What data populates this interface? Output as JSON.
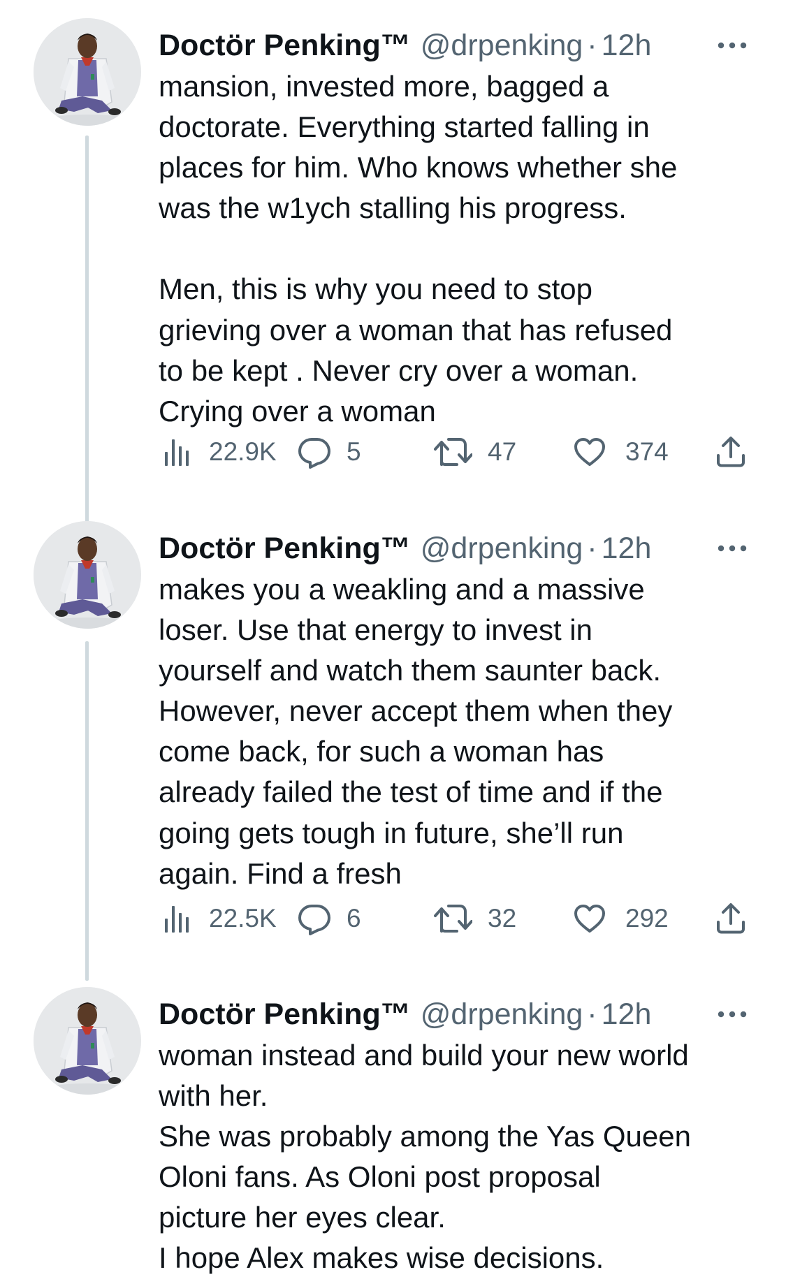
{
  "tweets": [
    {
      "author": {
        "display_name": "Doctör Penking™",
        "handle": "@drpenking"
      },
      "separator": "·",
      "time": "12h",
      "text": "mansion, invested more, bagged a\ndoctorate. Everything started falling in\nplaces for him. Who knows whether she\nwas the w1ych stalling his progress.\n\nMen, this is why you need to stop\ngrieving over a woman that has refused\nto be kept . Never cry over a woman.\nCrying over a woman",
      "stats": {
        "views": "22.9K",
        "replies": "5",
        "retweets": "47",
        "likes": "374"
      }
    },
    {
      "author": {
        "display_name": "Doctör Penking™",
        "handle": "@drpenking"
      },
      "separator": "·",
      "time": "12h",
      "text": "makes you a weakling and a massive\nloser. Use that energy to invest in\nyourself and watch them saunter back.\nHowever, never accept them when they\ncome back, for such a woman has\nalready failed the test of time and if the\ngoing gets tough in future, she’ll run\nagain. Find a fresh",
      "stats": {
        "views": "22.5K",
        "replies": "6",
        "retweets": "32",
        "likes": "292"
      }
    },
    {
      "author": {
        "display_name": "Doctör Penking™",
        "handle": "@drpenking"
      },
      "separator": "·",
      "time": "12h",
      "text": "woman instead and build your new world\nwith her.\nShe was probably among the Yas Queen\nOloni fans. As Oloni post proposal\npicture her eyes clear.\nI hope Alex makes wise decisions."
    }
  ],
  "colors": {
    "text_primary": "#0f1419",
    "text_secondary": "#536471",
    "thread_line": "#cfd9de",
    "background": "#ffffff"
  },
  "icons": {
    "more": "more-horizontal-icon",
    "views": "analytics-bars-icon",
    "reply": "reply-bubble-icon",
    "retweet": "retweet-arrows-icon",
    "like": "heart-icon",
    "share": "share-upload-icon"
  }
}
